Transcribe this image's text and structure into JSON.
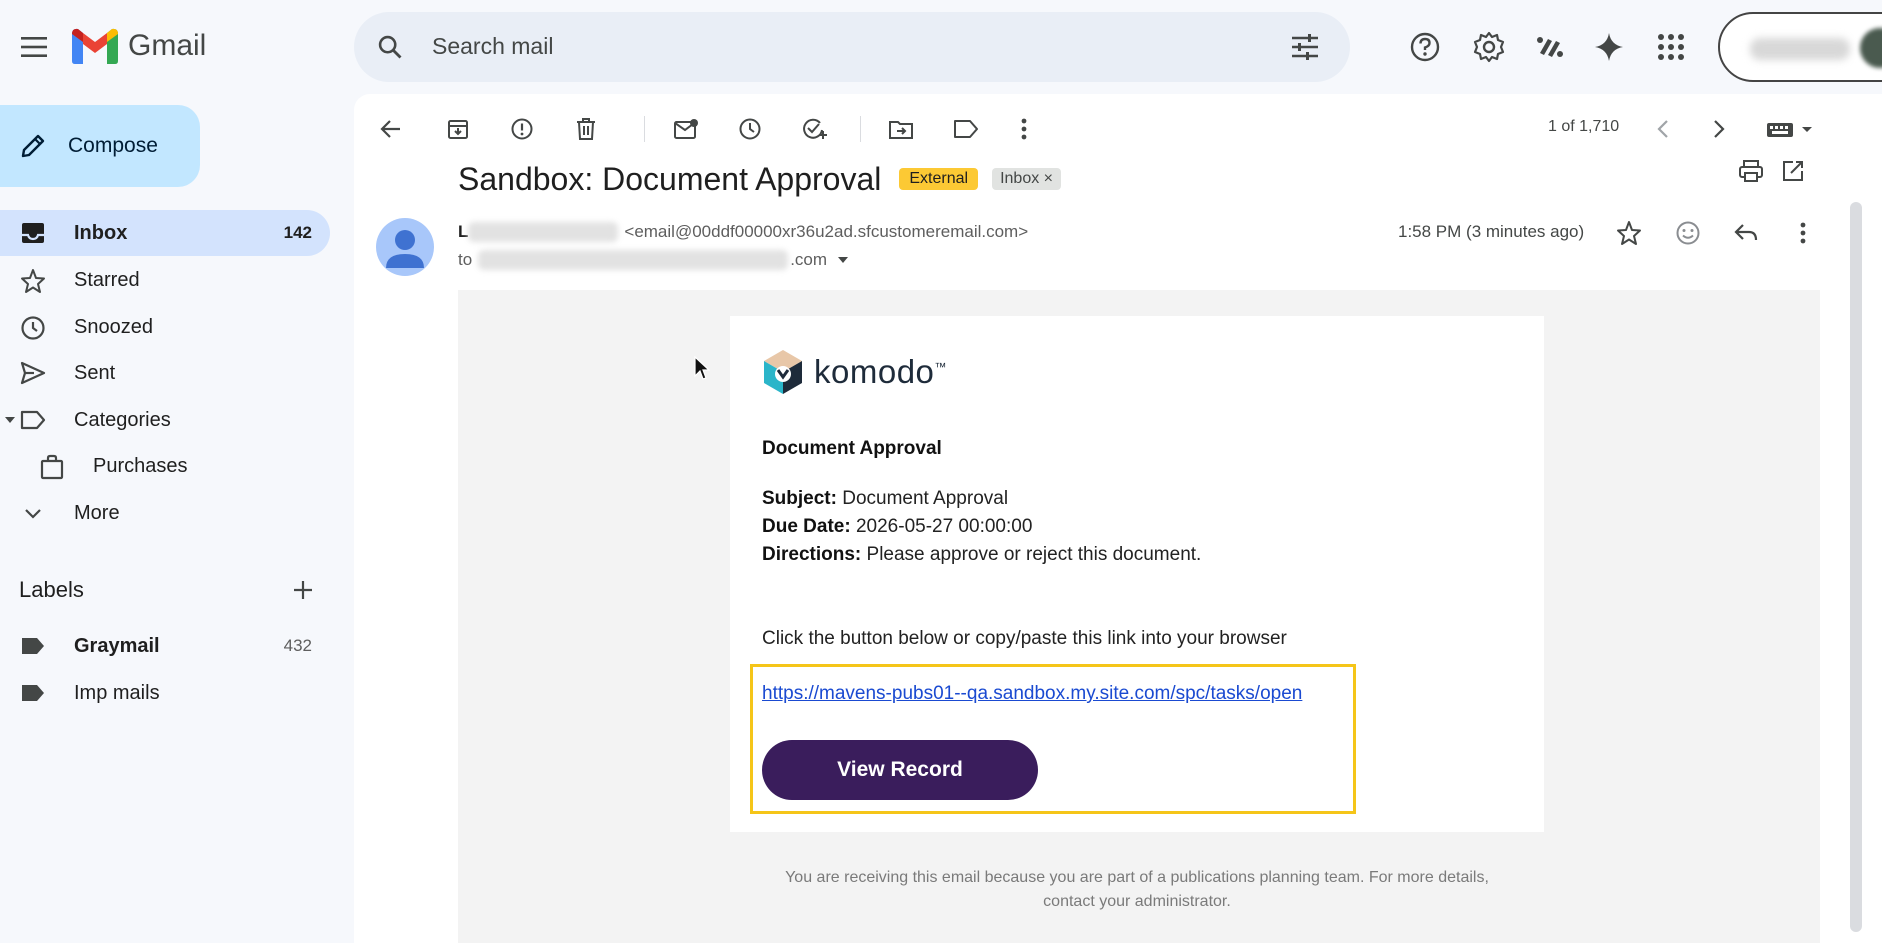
{
  "app": {
    "name": "Gmail"
  },
  "search": {
    "placeholder": "Search mail"
  },
  "sidebar": {
    "compose_label": "Compose",
    "items": [
      {
        "label": "Inbox",
        "count": "142"
      },
      {
        "label": "Starred"
      },
      {
        "label": "Snoozed"
      },
      {
        "label": "Sent"
      },
      {
        "label": "Categories"
      },
      {
        "label": "Purchases"
      },
      {
        "label": "More"
      }
    ],
    "labels_header": "Labels",
    "labels": [
      {
        "label": "Graymail",
        "count": "432"
      },
      {
        "label": "Imp mails"
      }
    ]
  },
  "toolbar": {
    "pager": "1 of 1,710"
  },
  "message": {
    "subject": "Sandbox: Document Approval",
    "badges": {
      "external": "External",
      "inbox": "Inbox"
    },
    "sender_email": "<email@00ddf00000xr36u2ad.sfcustomeremail.com>",
    "to_prefix": "to",
    "to_suffix": ".com",
    "time": "1:58 PM (3 minutes ago)"
  },
  "email": {
    "brand": "komodo",
    "brand_mark": "™",
    "title": "Document Approval",
    "subject_label": "Subject:",
    "subject_value": "Document Approval",
    "due_label": "Due Date:",
    "due_value": "2026-05-27 00:00:00",
    "directions_label": "Directions:",
    "directions_value": "Please approve or reject this document.",
    "cta_text": "Click the button below or copy/paste this link into your browser",
    "link": "https://mavens-pubs01--qa.sandbox.my.site.com/spc/tasks/open",
    "button_label": "View Record",
    "footer_line1": "You are receiving this email because you are part of a publications planning team. For more details,",
    "footer_line2": "contact your administrator."
  },
  "colors": {
    "accent_compose": "#c2e7ff",
    "active_nav": "#d3e3fd",
    "badge_external": "#fcc934",
    "button": "#3a1d5c",
    "highlight": "#f5c518",
    "link": "#1a4ad1"
  }
}
